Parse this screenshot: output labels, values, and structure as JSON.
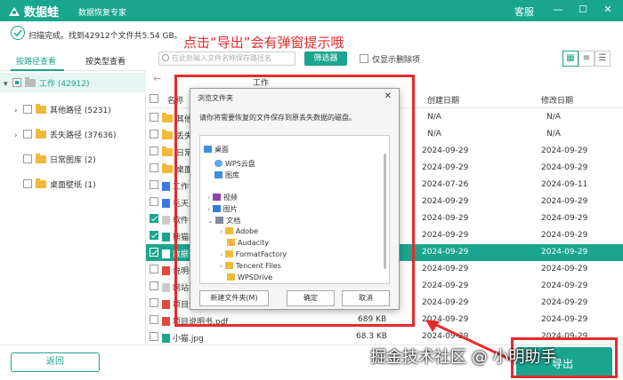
{
  "app": {
    "title": "数据蛙",
    "subtitle": "数据恢复专家",
    "support": "客服",
    "min": "—",
    "max": "☐",
    "close": "✕"
  },
  "status": {
    "text": "扫描完成。找到42912个文件共5.54 GB。"
  },
  "annotation": "点击“导出”会有弹窗提示哦",
  "tabs": {
    "by_path": "按路径查看",
    "by_type": "按类型查看"
  },
  "tree": [
    {
      "label": "工作 (42912)"
    },
    {
      "label": "其他路径 (5231)"
    },
    {
      "label": "丢失路径 (37636)"
    },
    {
      "label": "日常图库 (2)"
    },
    {
      "label": "桌面壁纸 (1)"
    }
  ],
  "toolbar": {
    "search_placeholder": "在此处输入文件名称保存路径名",
    "filter": "筛选器",
    "show_deleted": "仅显示删除项"
  },
  "nav": {
    "back": "←",
    "path": "工作"
  },
  "table": {
    "headers": {
      "name": "名称",
      "created": "创建日期",
      "modified": "修改日期"
    },
    "rows": [
      {
        "name": "其他路径",
        "size": "",
        "created": "N/A",
        "modified": "N/A"
      },
      {
        "name": "丢失路径",
        "size": "",
        "created": "N/A",
        "modified": "N/A"
      },
      {
        "name": "日常图库",
        "size": "",
        "created": "2024-09-29",
        "modified": "2024-09-29"
      },
      {
        "name": "桌面壁纸",
        "size": "",
        "created": "2024-09-29",
        "modified": "2024-09-29"
      },
      {
        "name": "工作计划",
        "size": "",
        "created": "2024-07-26",
        "modified": "2024-09-11"
      },
      {
        "name": "毛天人",
        "size": "",
        "created": "2024-09-29",
        "modified": "2024-09-29"
      },
      {
        "name": "软件介绍",
        "size": "",
        "created": "2024-09-29",
        "modified": "2024-09-29"
      },
      {
        "name": "熊猫的",
        "size": "",
        "created": "2024-09-29",
        "modified": "2024-09-29"
      },
      {
        "name": "数据说明",
        "size": "",
        "created": "2024-09-29",
        "modified": "2024-09-29"
      },
      {
        "name": "说明书",
        "size": "",
        "created": "2024-09-29",
        "modified": "2024-09-29"
      },
      {
        "name": "网站数据",
        "size": "",
        "created": "2024-09-29",
        "modified": "2024-09-29"
      },
      {
        "name": "项目说明",
        "size": "",
        "created": "2024-09-29",
        "modified": "2024-09-29"
      },
      {
        "name": "项目说明书.pdf",
        "size": "689 KB",
        "created": "2024-09-29",
        "modified": "2024-09-29"
      },
      {
        "name": "小猫.jpg",
        "size": "68.3 KB",
        "created": "2024-09-29",
        "modified": "2024-09-29"
      }
    ]
  },
  "dialog": {
    "title": "浏览文件夹",
    "message": "请你将需要恢复的文件保存到原丢失数据的磁盘。",
    "items": [
      "桌面",
      "WPS云盘",
      "图库",
      "视频",
      "图片",
      "文档",
      "Adobe",
      "Audacity",
      "FormatFactory",
      "Tencent Files",
      "WPSDrive"
    ],
    "new_folder": "新建文件夹(M)",
    "ok": "确定",
    "cancel": "取消"
  },
  "bottom": {
    "back": "返回",
    "export": "导出"
  },
  "watermark": "掘金技术社区 @ 小明助手",
  "colors": {
    "accent": "#1aa58f",
    "annotation": "#e52b2b"
  }
}
